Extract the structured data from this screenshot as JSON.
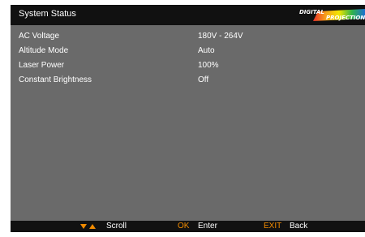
{
  "header": {
    "title": "System Status",
    "logo": {
      "line1": "DIGITAL",
      "line2": "PROJECTION"
    }
  },
  "rows": [
    {
      "label": "AC Voltage",
      "value": "180V - 264V"
    },
    {
      "label": "Altitude Mode",
      "value": "Auto"
    },
    {
      "label": "Laser Power",
      "value": "100%"
    },
    {
      "label": "Constant Brightness",
      "value": "Off"
    }
  ],
  "footer": {
    "scroll_icons": "up-down-arrows-icon",
    "scroll_label": "Scroll",
    "ok_key": "OK",
    "ok_label": "Enter",
    "exit_key": "EXIT",
    "exit_label": "Back"
  },
  "colors": {
    "header_bg": "#111111",
    "body_bg": "#6a6a6a",
    "accent": "#f08a00"
  }
}
